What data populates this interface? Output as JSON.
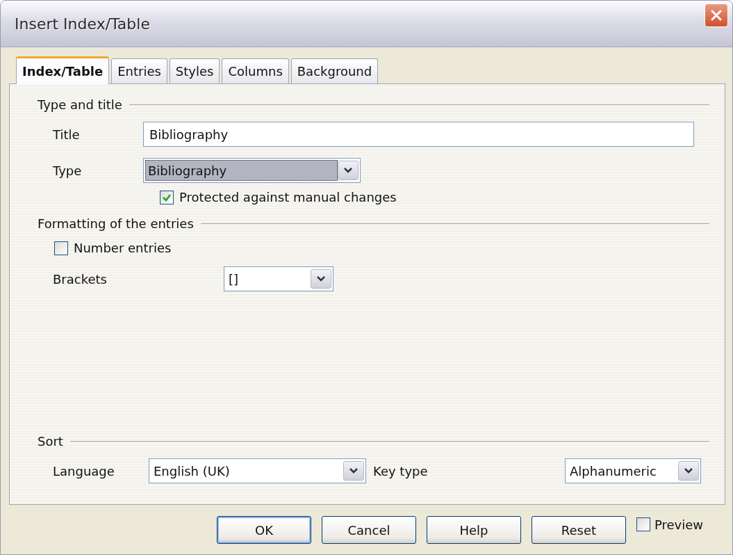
{
  "window": {
    "title": "Insert Index/Table"
  },
  "tabs": [
    {
      "label": "Index/Table",
      "selected": true
    },
    {
      "label": "Entries",
      "selected": false
    },
    {
      "label": "Styles",
      "selected": false
    },
    {
      "label": "Columns",
      "selected": false
    },
    {
      "label": "Background",
      "selected": false
    }
  ],
  "type_and_title": {
    "heading": "Type and title",
    "title": {
      "label": "Title",
      "value": "Bibliography"
    },
    "type": {
      "label": "Type",
      "value": "Bibliography",
      "focused": true
    },
    "protected": {
      "label": "Protected against manual changes",
      "checked": true
    }
  },
  "formatting": {
    "heading": "Formatting of the entries",
    "number_entries": {
      "label": "Number entries",
      "checked": false
    },
    "brackets": {
      "label": "Brackets",
      "value": "[]",
      "focused": false
    }
  },
  "sort": {
    "heading": "Sort",
    "language": {
      "label": "Language",
      "value": "English (UK)",
      "focused": false
    },
    "key_type": {
      "label": "Key type",
      "value": "Alphanumeric",
      "focused": false
    }
  },
  "buttons": [
    {
      "label": "OK",
      "default": true
    },
    {
      "label": "Cancel",
      "default": false
    },
    {
      "label": "Help",
      "default": false
    },
    {
      "label": "Reset",
      "default": false
    }
  ],
  "preview": {
    "label": "Preview",
    "checked": false
  }
}
